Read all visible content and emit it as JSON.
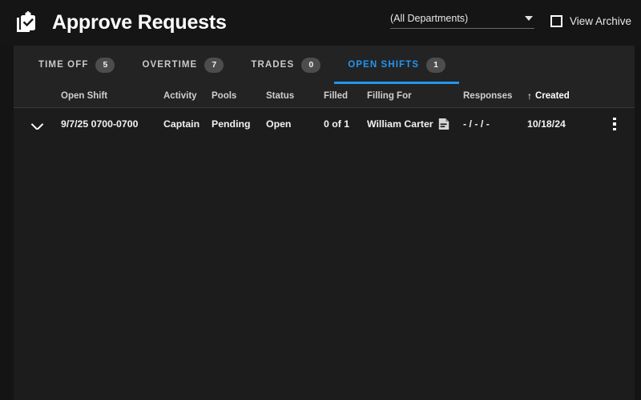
{
  "header": {
    "title": "Approve Requests",
    "icon": "clipboard-check-icon",
    "department_filter": {
      "value": "(All Departments)",
      "icon": "chevron-down-icon"
    },
    "archive_toggle": {
      "label": "View Archive",
      "checked": false
    }
  },
  "tabs": [
    {
      "label": "TIME OFF",
      "count": "5",
      "active": false
    },
    {
      "label": "OVERTIME",
      "count": "7",
      "active": false
    },
    {
      "label": "TRADES",
      "count": "0",
      "active": false
    },
    {
      "label": "OPEN SHIFTS",
      "count": "1",
      "active": true
    }
  ],
  "table": {
    "columns": {
      "open_shift": "Open Shift",
      "activity": "Activity",
      "pools": "Pools",
      "status": "Status",
      "filled": "Filled",
      "filling_for": "Filling For",
      "responses": "Responses",
      "created": "Created"
    },
    "sort": {
      "column": "Created",
      "direction": "asc",
      "arrow": "↑"
    },
    "rows": [
      {
        "expand_icon": "chevron-down-icon",
        "open_shift": "9/7/25 0700-0700",
        "activity": "Captain",
        "pools": "Pending",
        "status": "Open",
        "filled": "0 of 1",
        "filling_for": "William Carter",
        "filling_for_icon": "note-document-icon",
        "responses": "- / - / -",
        "created": "10/18/24",
        "menu_icon": "kebab-menu-icon"
      }
    ]
  },
  "colors": {
    "accent": "#2196f3",
    "page_bg": "#141414",
    "panel_bg": "#232323",
    "table_bg": "#1c1c1c",
    "badge_bg": "#4d4d4d",
    "text": "#f2f2f2"
  }
}
